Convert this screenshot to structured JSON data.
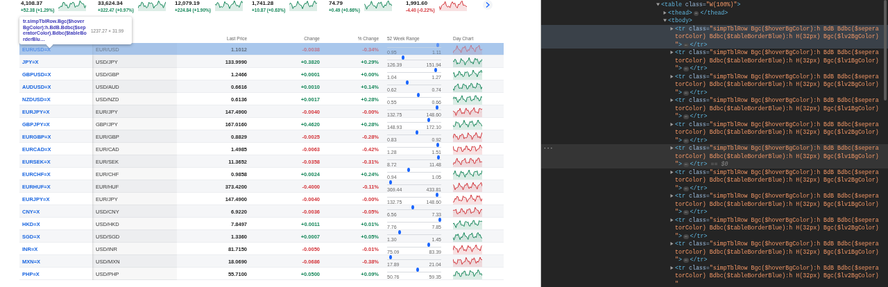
{
  "tickers": [
    {
      "value": "4,108.37",
      "change": "+52.38 (+1.29%)",
      "gain": true
    },
    {
      "value": "33,624.34",
      "change": "+322.47 (+0.97%)",
      "gain": true
    },
    {
      "value": "12,079.19",
      "change": "+224.84 (+1.90%)",
      "gain": true
    },
    {
      "value": "1,741.28",
      "change": "+10.87 (+0.63%)",
      "gain": true
    },
    {
      "value": "74.79",
      "change": "+0.49 (+0.66%)",
      "gain": true
    },
    {
      "value": "1,991.60",
      "change": "-4.40 (-0.22%)",
      "gain": false
    }
  ],
  "inspect_tooltip": {
    "selector": "tr.simpTblRow.Bgc($hoverBgColor):h.BdB.Bdbc($seperatorColor).Bdbc($tableBorderBlu…",
    "size": "1237.27 × 31.99"
  },
  "table": {
    "columns": [
      "Last Price",
      "Change",
      "% Change",
      "52 Week Range",
      "Day Chart"
    ],
    "rows": [
      {
        "symbol": "EURUSD=X",
        "name": "EUR/USD",
        "last_price": "1.1012",
        "change": "-0.0038",
        "pct_change": "-0.34%",
        "gain": false,
        "range_low": "0.95",
        "range_high": "1.11",
        "level": 0.94,
        "highlighted": true
      },
      {
        "symbol": "JPY=X",
        "name": "USD/JPY",
        "last_price": "133.9990",
        "change": "+0.3820",
        "pct_change": "+0.29%",
        "gain": true,
        "range_low": "126.39",
        "range_high": "151.94",
        "level": 0.3,
        "highlighted": false
      },
      {
        "symbol": "GBPUSD=X",
        "name": "USD/GBP",
        "last_price": "1.2466",
        "change": "+0.0001",
        "pct_change": "+0.00%",
        "gain": true,
        "range_low": "1.04",
        "range_high": "1.27",
        "level": 0.9,
        "highlighted": false
      },
      {
        "symbol": "AUDUSD=X",
        "name": "USD/AUD",
        "last_price": "0.6616",
        "change": "+0.0010",
        "pct_change": "+0.14%",
        "gain": true,
        "range_low": "0.62",
        "range_high": "0.74",
        "level": 0.37,
        "highlighted": false
      },
      {
        "symbol": "NZDUSD=X",
        "name": "USD/NZD",
        "last_price": "0.6136",
        "change": "+0.0017",
        "pct_change": "+0.28%",
        "gain": true,
        "range_low": "0.55",
        "range_high": "0.66",
        "level": 0.58,
        "highlighted": false
      },
      {
        "symbol": "EURJPY=X",
        "name": "EUR/JPY",
        "last_price": "147.4900",
        "change": "-0.0040",
        "pct_change": "-0.00%",
        "gain": false,
        "range_low": "132.75",
        "range_high": "148.60",
        "level": 0.92,
        "highlighted": false
      },
      {
        "symbol": "GBPJPY=X",
        "name": "GBP/JPY",
        "last_price": "167.0160",
        "change": "+0.4620",
        "pct_change": "+0.28%",
        "gain": true,
        "range_low": "148.93",
        "range_high": "172.10",
        "level": 0.77,
        "highlighted": false
      },
      {
        "symbol": "EURGBP=X",
        "name": "EUR/GBP",
        "last_price": "0.8829",
        "change": "-0.0025",
        "pct_change": "-0.28%",
        "gain": false,
        "range_low": "0.83",
        "range_high": "0.92",
        "level": 0.55,
        "highlighted": false
      },
      {
        "symbol": "EURCAD=X",
        "name": "EUR/CAD",
        "last_price": "1.4985",
        "change": "-0.0063",
        "pct_change": "-0.42%",
        "gain": false,
        "range_low": "1.28",
        "range_high": "1.51",
        "level": 0.94,
        "highlighted": false
      },
      {
        "symbol": "EURSEK=X",
        "name": "EUR/SEK",
        "last_price": "11.3652",
        "change": "-0.0358",
        "pct_change": "-0.31%",
        "gain": false,
        "range_low": "8.72",
        "range_high": "11.48",
        "level": 0.95,
        "highlighted": false
      },
      {
        "symbol": "EURCHF=X",
        "name": "EUR/CHF",
        "last_price": "0.9858",
        "change": "+0.0024",
        "pct_change": "+0.24%",
        "gain": true,
        "range_low": "0.94",
        "range_high": "1.05",
        "level": 0.4,
        "highlighted": false
      },
      {
        "symbol": "EURHUF=X",
        "name": "EUR/HUF",
        "last_price": "373.4200",
        "change": "-0.4000",
        "pct_change": "-0.11%",
        "gain": false,
        "range_low": "369.44",
        "range_high": "433.81",
        "level": 0.07,
        "highlighted": false
      },
      {
        "symbol": "EURJPY=X",
        "name": "EUR/JPY",
        "last_price": "147.4900",
        "change": "-0.0040",
        "pct_change": "-0.00%",
        "gain": false,
        "range_low": "132.75",
        "range_high": "148.60",
        "level": 0.92,
        "highlighted": false
      },
      {
        "symbol": "CNY=X",
        "name": "USD/CNY",
        "last_price": "6.9220",
        "change": "-0.0036",
        "pct_change": "-0.05%",
        "gain": false,
        "range_low": "6.56",
        "range_high": "7.33",
        "level": 0.48,
        "highlighted": false
      },
      {
        "symbol": "HKD=X",
        "name": "USD/HKD",
        "last_price": "7.8497",
        "change": "+0.0011",
        "pct_change": "+0.01%",
        "gain": true,
        "range_low": "7.76",
        "range_high": "7.85",
        "level": 0.97,
        "highlighted": false
      },
      {
        "symbol": "SGD=X",
        "name": "USD/SGD",
        "last_price": "1.3360",
        "change": "+0.0007",
        "pct_change": "+0.05%",
        "gain": true,
        "range_low": "1.30",
        "range_high": "1.45",
        "level": 0.23,
        "highlighted": false
      },
      {
        "symbol": "INR=X",
        "name": "USD/INR",
        "last_price": "81.7150",
        "change": "-0.0050",
        "pct_change": "-0.01%",
        "gain": false,
        "range_low": "75.09",
        "range_high": "83.39",
        "level": 0.77,
        "highlighted": false
      },
      {
        "symbol": "MXN=X",
        "name": "USD/MXN",
        "last_price": "18.0690",
        "change": "-0.0686",
        "pct_change": "-0.38%",
        "gain": false,
        "range_low": "17.89",
        "range_high": "21.04",
        "level": 0.07,
        "highlighted": false
      },
      {
        "symbol": "PHP=X",
        "name": "USD/PHP",
        "last_price": "55.7100",
        "change": "+0.0500",
        "pct_change": "+0.09%",
        "gain": true,
        "range_low": "50.76",
        "range_high": "59.35",
        "level": 0.57,
        "highlighted": false
      }
    ]
  },
  "devtools": {
    "tree": [
      {
        "tag_open": "<table",
        "attr_name": "class=",
        "attr_value": "\"W(100%)\"",
        "tag_close": ">",
        "expanded": true,
        "hovered": false,
        "selected": false,
        "children": [
          {
            "tag_open": "<thead>",
            "ellipsis": "⋯",
            "end_tag": "</thead>",
            "expanded": false,
            "hovered": false,
            "selected": false
          },
          {
            "tag_open": "<tbody>",
            "expanded": true,
            "hovered": false,
            "selected": false,
            "children": [
              {
                "tag_open": "<tr",
                "attr_name": "class=",
                "attr_value": "\"simpTblRow Bgc($hoverBgColor):h BdB Bdbc($seperatorColor) Bdbc($tableBorderBlue):h H(32px) Bgc($lv2BgColor)\"",
                "tag_close": ">",
                "ellipsis": "⋯",
                "end_tag": "</tr>",
                "expanded": false,
                "hovered": true,
                "selected": false
              },
              {
                "tag_open": "<tr",
                "attr_name": "class=",
                "attr_value": "\"simpTblRow Bgc($hoverBgColor):h BdB Bdbc($seperatorColor) Bdbc($tableBorderBlue):h H(32px) Bgc($lv1BgColor)\"",
                "tag_close": ">",
                "ellipsis": "⋯",
                "end_tag": "</tr>",
                "expanded": false,
                "hovered": false,
                "selected": false
              },
              {
                "tag_open": "<tr",
                "attr_name": "class=",
                "attr_value": "\"simpTblRow Bgc($hoverBgColor):h BdB Bdbc($seperatorColor) Bdbc($tableBorderBlue):h H(32px) Bgc($lv2BgColor)\"",
                "tag_close": ">",
                "ellipsis": "⋯",
                "end_tag": "</tr>",
                "expanded": false,
                "hovered": false,
                "selected": false
              },
              {
                "tag_open": "<tr",
                "attr_name": "class=",
                "attr_value": "\"simpTblRow Bgc($hoverBgColor):h BdB Bdbc($seperatorColor) Bdbc($tableBorderBlue):h H(32px) Bgc($lv1BgColor)\"",
                "tag_close": ">",
                "ellipsis": "⋯",
                "end_tag": "</tr>",
                "expanded": false,
                "hovered": false,
                "selected": false
              },
              {
                "tag_open": "<tr",
                "attr_name": "class=",
                "attr_value": "\"simpTblRow Bgc($hoverBgColor):h BdB Bdbc($seperatorColor) Bdbc($tableBorderBlue):h H(32px) Bgc($lv2BgColor)\"",
                "tag_close": ">",
                "ellipsis": "⋯",
                "end_tag": "</tr>",
                "expanded": false,
                "hovered": false,
                "selected": false
              },
              {
                "tag_open": "<tr",
                "attr_name": "class=",
                "attr_value": "\"simpTblRow Bgc($hoverBgColor):h BdB Bdbc($seperatorColor) Bdbc($tableBorderBlue):h H(32px) Bgc($lv1BgColor)\"",
                "tag_close": ">",
                "ellipsis": "⋯",
                "end_tag": "</tr>",
                "marker": "== $0",
                "gutter": "···",
                "expanded": false,
                "hovered": false,
                "selected": true
              },
              {
                "tag_open": "<tr",
                "attr_name": "class=",
                "attr_value": "\"simpTblRow Bgc($hoverBgColor):h BdB Bdbc($seperatorColor) Bdbc($tableBorderBlue):h H(32px) Bgc($lv2BgColor)\"",
                "tag_close": ">",
                "ellipsis": "⋯",
                "end_tag": "</tr>",
                "expanded": false,
                "hovered": false,
                "selected": false
              },
              {
                "tag_open": "<tr",
                "attr_name": "class=",
                "attr_value": "\"simpTblRow Bgc($hoverBgColor):h BdB Bdbc($seperatorColor) Bdbc($tableBorderBlue):h H(32px) Bgc($lv1BgColor)\"",
                "tag_close": ">",
                "ellipsis": "⋯",
                "end_tag": "</tr>",
                "expanded": false,
                "hovered": false,
                "selected": false
              },
              {
                "tag_open": "<tr",
                "attr_name": "class=",
                "attr_value": "\"simpTblRow Bgc($hoverBgColor):h BdB Bdbc($seperatorColor) Bdbc($tableBorderBlue):h H(32px) Bgc($lv2BgColor)\"",
                "tag_close": ">",
                "ellipsis": "⋯",
                "end_tag": "</tr>",
                "expanded": false,
                "hovered": false,
                "selected": false
              },
              {
                "tag_open": "<tr",
                "attr_name": "class=",
                "attr_value": "\"simpTblRow Bgc($hoverBgColor):h BdB Bdbc($seperatorColor) Bdbc($tableBorderBlue):h H(32px) Bgc($lv1BgColor)\"",
                "tag_close": ">",
                "ellipsis": "⋯",
                "end_tag": "</tr>",
                "expanded": false,
                "hovered": false,
                "selected": false
              },
              {
                "tag_open": "<tr",
                "attr_name": "class=",
                "attr_value": "\"simpTblRow Bgc($hoverBgColor):h BdB Bdbc($seperatorColor) Bdbc($tableBorderBlue):h H(32px) Bgc($lv2BgColor)\"",
                "expanded": false,
                "hovered": false,
                "selected": false
              }
            ]
          }
        ]
      }
    ]
  }
}
